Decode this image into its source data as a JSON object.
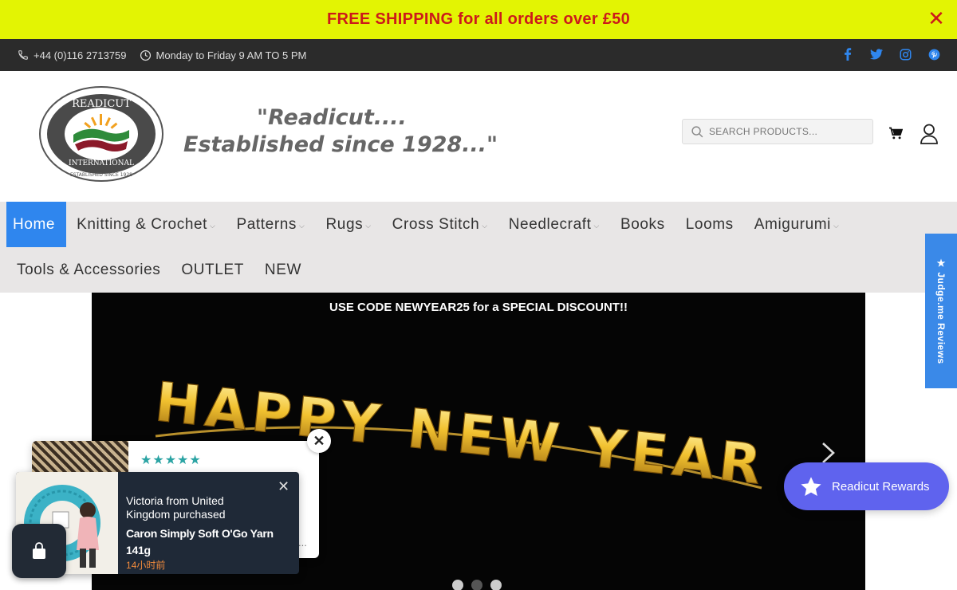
{
  "promo": {
    "text": "FREE SHIPPING for all orders over £50",
    "close_icon": "close-icon",
    "bg": "#e3f403",
    "color": "#cc1a1a"
  },
  "info_bar": {
    "phone": "+44 (0)116 2713759",
    "hours": "Monday to Friday 9 AM TO 5 PM",
    "socials": [
      "facebook-icon",
      "twitter-icon",
      "instagram-icon",
      "pinterest-icon"
    ],
    "social_color": "#2f86ee"
  },
  "header": {
    "logo": {
      "top_text": "READICUT",
      "bottom_text": "INTERNATIONAL",
      "est": "ESTABLISHED SINCE 1928"
    },
    "tagline_line1": "\"Readicut....",
    "tagline_line2": "Established since 1928...\"",
    "search_placeholder": "SEARCH PRODUCTS...",
    "icons": [
      "search-icon",
      "cart-icon",
      "user-icon"
    ]
  },
  "nav": {
    "row1": [
      {
        "label": "Home",
        "dropdown": false,
        "active": true
      },
      {
        "label": "Knitting & Crochet",
        "dropdown": true
      },
      {
        "label": "Patterns",
        "dropdown": true
      },
      {
        "label": "Rugs",
        "dropdown": true
      },
      {
        "label": "Cross Stitch",
        "dropdown": true
      },
      {
        "label": "Needlecraft",
        "dropdown": true
      },
      {
        "label": "Books",
        "dropdown": false
      },
      {
        "label": "Looms",
        "dropdown": false
      },
      {
        "label": "Amigurumi",
        "dropdown": true
      }
    ],
    "row2": [
      {
        "label": "Tools & Accessories",
        "dropdown": false
      },
      {
        "label": "OUTLET",
        "dropdown": false
      },
      {
        "label": "NEW",
        "dropdown": false
      }
    ],
    "active_color": "#2f86ee"
  },
  "hero": {
    "code_text": "USE CODE NEWYEAR25 for a SPECIAL DISCOUNT!!",
    "banner_text": "HAPPY NEW YEAR",
    "slides": 3,
    "active_slide": 2
  },
  "judgeme": {
    "label": "★ Judge.me Reviews",
    "bg": "#3a89e8"
  },
  "rewards": {
    "label": "Readicut Rewards",
    "bg": "#5f63ee"
  },
  "review_popup": {
    "stars": "★★★★★",
    "ellipsis": "..."
  },
  "purchase_popup": {
    "who": "Victoria from United Kingdom purchased",
    "product": "Caron Simply Soft O'Go Yarn 141g",
    "time": "14小时前"
  }
}
